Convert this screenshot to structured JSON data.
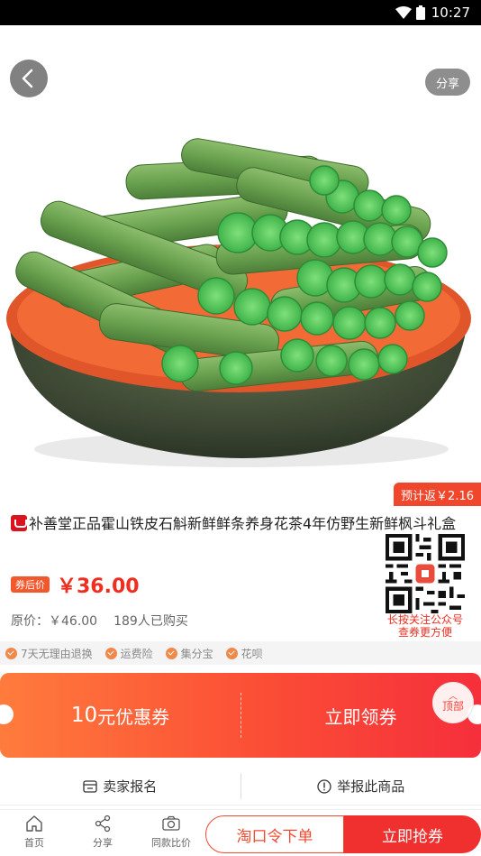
{
  "status_bar": {
    "time": "10:27"
  },
  "header": {
    "share_label": "分享"
  },
  "product": {
    "rebate": "预计返￥2.16",
    "title": "补善堂正品霍山铁皮石斛新鲜鲜条养身花茶4年仿野生新鲜枫斗礼盒",
    "coupon_tag": "券后价",
    "price": "￥36.00",
    "original_price": "原价：￥46.00",
    "sold": "189人已购买",
    "qr_caption_line1": "长按关注公众号",
    "qr_caption_line2": "查券更方便"
  },
  "services": [
    "7天无理由退换",
    "运费险",
    "集分宝",
    "花呗"
  ],
  "coupon": {
    "amount_number": "10",
    "amount_suffix": "元优惠券",
    "claim_label": "立即领券",
    "top_button_label": "顶部"
  },
  "actions": {
    "seller_signup": "卖家报名",
    "report": "举报此商品"
  },
  "bottom_bar": {
    "tabs": [
      {
        "label": "首页",
        "icon": "home-icon"
      },
      {
        "label": "分享",
        "icon": "share-icon"
      },
      {
        "label": "同款比价",
        "icon": "camera-icon"
      }
    ],
    "code_order": "淘口令下单",
    "buy_now": "立即抢券"
  },
  "colors": {
    "accent": "#f02f2f",
    "orange": "#ff7b3c",
    "text": "#222222"
  }
}
